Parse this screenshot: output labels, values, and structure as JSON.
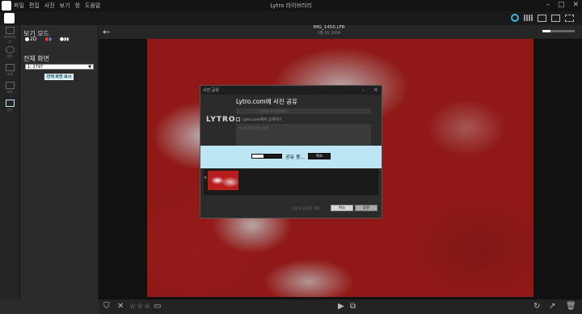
{
  "app": {
    "window_title": "Lytro 라이브러리",
    "menu": [
      "파일",
      "편집",
      "사진",
      "보기",
      "창",
      "도움말"
    ]
  },
  "window_controls": [
    "–",
    "□",
    "✕"
  ],
  "toolbar": {
    "view_modes": [
      "circle-icon",
      "grid-icon",
      "single-view-icon",
      "filmstrip-icon",
      "fullscreen-icon"
    ],
    "accent": "#34b6e0"
  },
  "rail": {
    "items": [
      "라이브러리",
      "정보",
      "조정",
      "보기",
      "공유"
    ]
  },
  "left_panel": {
    "view_mode_label": "보기 모드",
    "view_options": [
      "2D",
      "",
      ""
    ],
    "fullscreen_label": "전체 화면",
    "display_select": "1: 2797",
    "fullscreen_button": "전체 화면 표시"
  },
  "viewer": {
    "filename": "IMG_1450.LFR",
    "date": "5월 10, 2019",
    "zoom_level": 0.25
  },
  "dialog": {
    "title": "사진 공유",
    "heading": "Lytro.com에 사진 공유",
    "logo": "LYTRO",
    "field_placeholder": "설명을 추가하세요",
    "checkbox_label": "Lytro.com에서 공개하기",
    "textarea_placeholder": "이 사진에 대한 설명",
    "progress_label": "공유 중...",
    "progress": 0.4,
    "cancel_upload": "취소",
    "footer_note": "다음에 공유를 계속",
    "cancel": "취소",
    "share": "공유"
  },
  "bottom": {
    "rating_stars": "☆☆☆"
  }
}
